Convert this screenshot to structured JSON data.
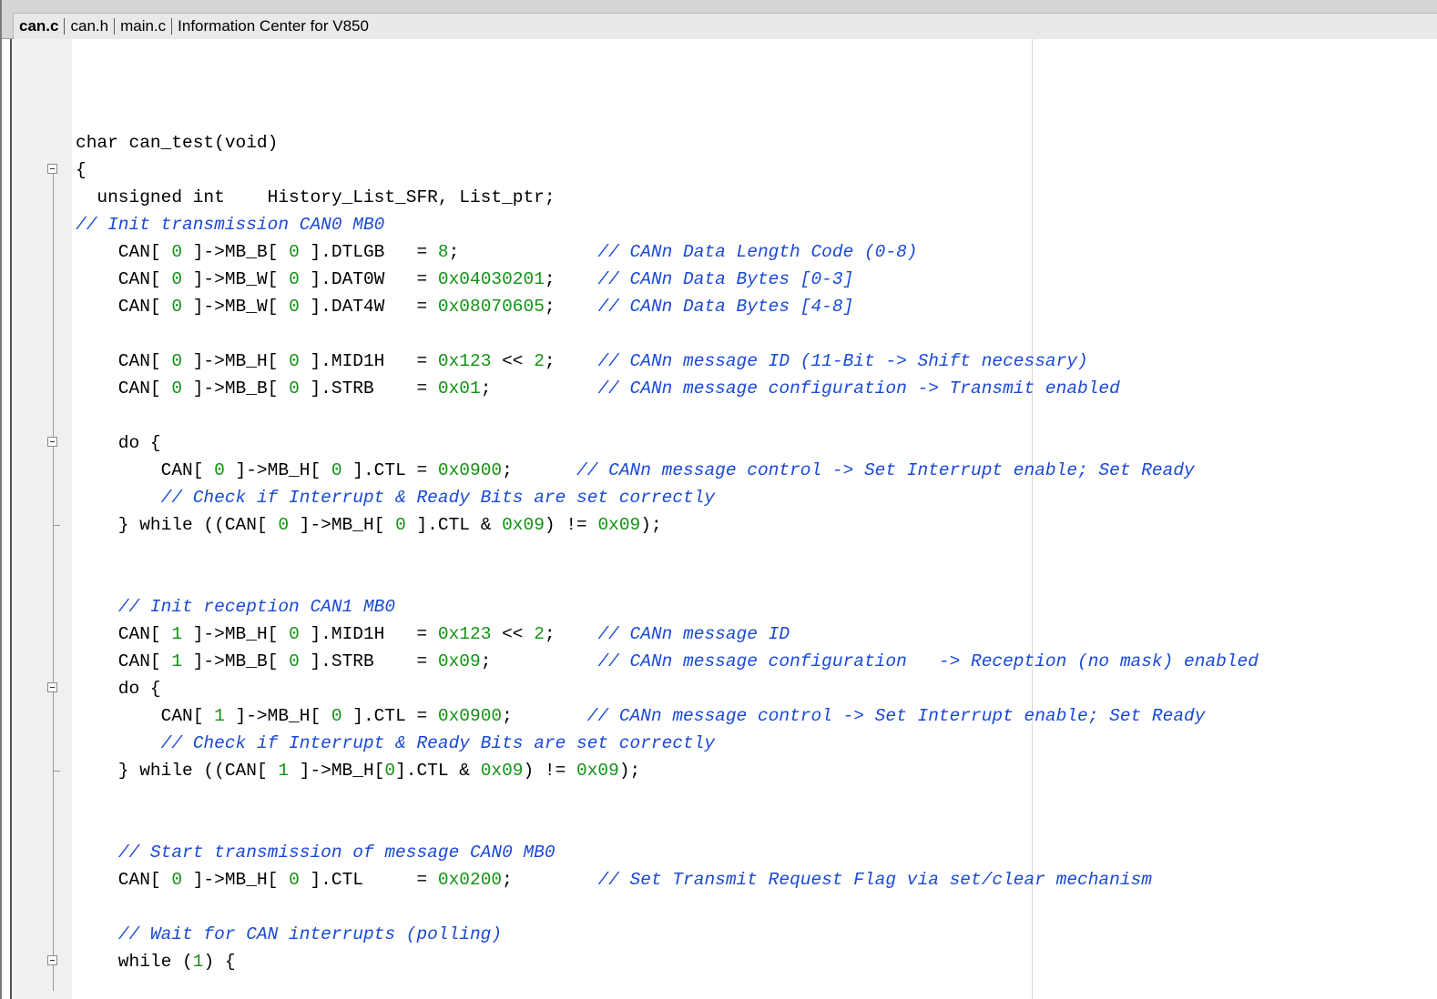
{
  "tabs": [
    {
      "label": "can.c",
      "active": true
    },
    {
      "label": "can.h",
      "active": false
    },
    {
      "label": "main.c",
      "active": false
    },
    {
      "label": "Information Center for V850",
      "active": false
    }
  ],
  "colors": {
    "comment": "#1a49d6",
    "number": "#169016",
    "text": "#000000"
  },
  "code_lines": [
    [
      {
        "t": "char can_test(void)"
      }
    ],
    [
      {
        "t": "{"
      }
    ],
    [
      {
        "t": "  unsigned int    History_List_SFR, List_ptr;"
      }
    ],
    [
      {
        "t": "// Init transmission CAN0 MB0",
        "c": "cm"
      }
    ],
    [
      {
        "t": "    CAN[ "
      },
      {
        "t": "0",
        "c": "num"
      },
      {
        "t": " ]->MB_B[ "
      },
      {
        "t": "0",
        "c": "num"
      },
      {
        "t": " ].DTLGB   = "
      },
      {
        "t": "8",
        "c": "num"
      },
      {
        "t": ";             "
      },
      {
        "t": "// CANn Data Length Code (0-8)",
        "c": "cm"
      }
    ],
    [
      {
        "t": "    CAN[ "
      },
      {
        "t": "0",
        "c": "num"
      },
      {
        "t": " ]->MB_W[ "
      },
      {
        "t": "0",
        "c": "num"
      },
      {
        "t": " ].DAT0W   = "
      },
      {
        "t": "0x04030201",
        "c": "num"
      },
      {
        "t": ";    "
      },
      {
        "t": "// CANn Data Bytes [0-3]",
        "c": "cm"
      }
    ],
    [
      {
        "t": "    CAN[ "
      },
      {
        "t": "0",
        "c": "num"
      },
      {
        "t": " ]->MB_W[ "
      },
      {
        "t": "0",
        "c": "num"
      },
      {
        "t": " ].DAT4W   = "
      },
      {
        "t": "0x08070605",
        "c": "num"
      },
      {
        "t": ";    "
      },
      {
        "t": "// CANn Data Bytes [4-8]",
        "c": "cm"
      }
    ],
    [
      {
        "t": ""
      }
    ],
    [
      {
        "t": "    CAN[ "
      },
      {
        "t": "0",
        "c": "num"
      },
      {
        "t": " ]->MB_H[ "
      },
      {
        "t": "0",
        "c": "num"
      },
      {
        "t": " ].MID1H   = "
      },
      {
        "t": "0x123",
        "c": "num"
      },
      {
        "t": " << "
      },
      {
        "t": "2",
        "c": "num"
      },
      {
        "t": ";    "
      },
      {
        "t": "// CANn message ID (11-Bit -> Shift necessary)",
        "c": "cm"
      }
    ],
    [
      {
        "t": "    CAN[ "
      },
      {
        "t": "0",
        "c": "num"
      },
      {
        "t": " ]->MB_B[ "
      },
      {
        "t": "0",
        "c": "num"
      },
      {
        "t": " ].STRB    = "
      },
      {
        "t": "0x01",
        "c": "num"
      },
      {
        "t": ";          "
      },
      {
        "t": "// CANn message configuration -> Transmit enabled",
        "c": "cm"
      }
    ],
    [
      {
        "t": ""
      }
    ],
    [
      {
        "t": "    do {"
      }
    ],
    [
      {
        "t": "        CAN[ "
      },
      {
        "t": "0",
        "c": "num"
      },
      {
        "t": " ]->MB_H[ "
      },
      {
        "t": "0",
        "c": "num"
      },
      {
        "t": " ].CTL = "
      },
      {
        "t": "0x0900",
        "c": "num"
      },
      {
        "t": ";      "
      },
      {
        "t": "// CANn message control -> Set Interrupt enable; Set Ready",
        "c": "cm"
      }
    ],
    [
      {
        "t": "        "
      },
      {
        "t": "// Check if Interrupt & Ready Bits are set correctly",
        "c": "cm"
      }
    ],
    [
      {
        "t": "    } while ((CAN[ "
      },
      {
        "t": "0",
        "c": "num"
      },
      {
        "t": " ]->MB_H[ "
      },
      {
        "t": "0",
        "c": "num"
      },
      {
        "t": " ].CTL & "
      },
      {
        "t": "0x09",
        "c": "num"
      },
      {
        "t": ") != "
      },
      {
        "t": "0x09",
        "c": "num"
      },
      {
        "t": ");"
      }
    ],
    [
      {
        "t": ""
      }
    ],
    [
      {
        "t": ""
      }
    ],
    [
      {
        "t": "    "
      },
      {
        "t": "// Init reception CAN1 MB0",
        "c": "cm"
      }
    ],
    [
      {
        "t": "    CAN[ "
      },
      {
        "t": "1",
        "c": "num"
      },
      {
        "t": " ]->MB_H[ "
      },
      {
        "t": "0",
        "c": "num"
      },
      {
        "t": " ].MID1H   = "
      },
      {
        "t": "0x123",
        "c": "num"
      },
      {
        "t": " << "
      },
      {
        "t": "2",
        "c": "num"
      },
      {
        "t": ";    "
      },
      {
        "t": "// CANn message ID",
        "c": "cm"
      }
    ],
    [
      {
        "t": "    CAN[ "
      },
      {
        "t": "1",
        "c": "num"
      },
      {
        "t": " ]->MB_B[ "
      },
      {
        "t": "0",
        "c": "num"
      },
      {
        "t": " ].STRB    = "
      },
      {
        "t": "0x09",
        "c": "num"
      },
      {
        "t": ";          "
      },
      {
        "t": "// CANn message configuration   -> Reception (no mask) enabled",
        "c": "cm"
      }
    ],
    [
      {
        "t": "    do {"
      }
    ],
    [
      {
        "t": "        CAN[ "
      },
      {
        "t": "1",
        "c": "num"
      },
      {
        "t": " ]->MB_H[ "
      },
      {
        "t": "0",
        "c": "num"
      },
      {
        "t": " ].CTL = "
      },
      {
        "t": "0x0900",
        "c": "num"
      },
      {
        "t": ";       "
      },
      {
        "t": "// CANn message control -> Set Interrupt enable; Set Ready",
        "c": "cm"
      }
    ],
    [
      {
        "t": "        "
      },
      {
        "t": "// Check if Interrupt & Ready Bits are set correctly",
        "c": "cm"
      }
    ],
    [
      {
        "t": "    } while ((CAN[ "
      },
      {
        "t": "1",
        "c": "num"
      },
      {
        "t": " ]->MB_H["
      },
      {
        "t": "0",
        "c": "num"
      },
      {
        "t": "].CTL & "
      },
      {
        "t": "0x09",
        "c": "num"
      },
      {
        "t": ") != "
      },
      {
        "t": "0x09",
        "c": "num"
      },
      {
        "t": ");"
      }
    ],
    [
      {
        "t": ""
      }
    ],
    [
      {
        "t": ""
      }
    ],
    [
      {
        "t": "    "
      },
      {
        "t": "// Start transmission of message CAN0 MB0",
        "c": "cm"
      }
    ],
    [
      {
        "t": "    CAN[ "
      },
      {
        "t": "0",
        "c": "num"
      },
      {
        "t": " ]->MB_H[ "
      },
      {
        "t": "0",
        "c": "num"
      },
      {
        "t": " ].CTL     = "
      },
      {
        "t": "0x0200",
        "c": "num"
      },
      {
        "t": ";        "
      },
      {
        "t": "// Set Transmit Request Flag via set/clear mechanism",
        "c": "cm"
      }
    ],
    [
      {
        "t": ""
      }
    ],
    [
      {
        "t": "    "
      },
      {
        "t": "// Wait for CAN interrupts (polling)",
        "c": "cm"
      }
    ],
    [
      {
        "t": "    while ("
      },
      {
        "t": "1",
        "c": "num"
      },
      {
        "t": ") {"
      }
    ]
  ]
}
